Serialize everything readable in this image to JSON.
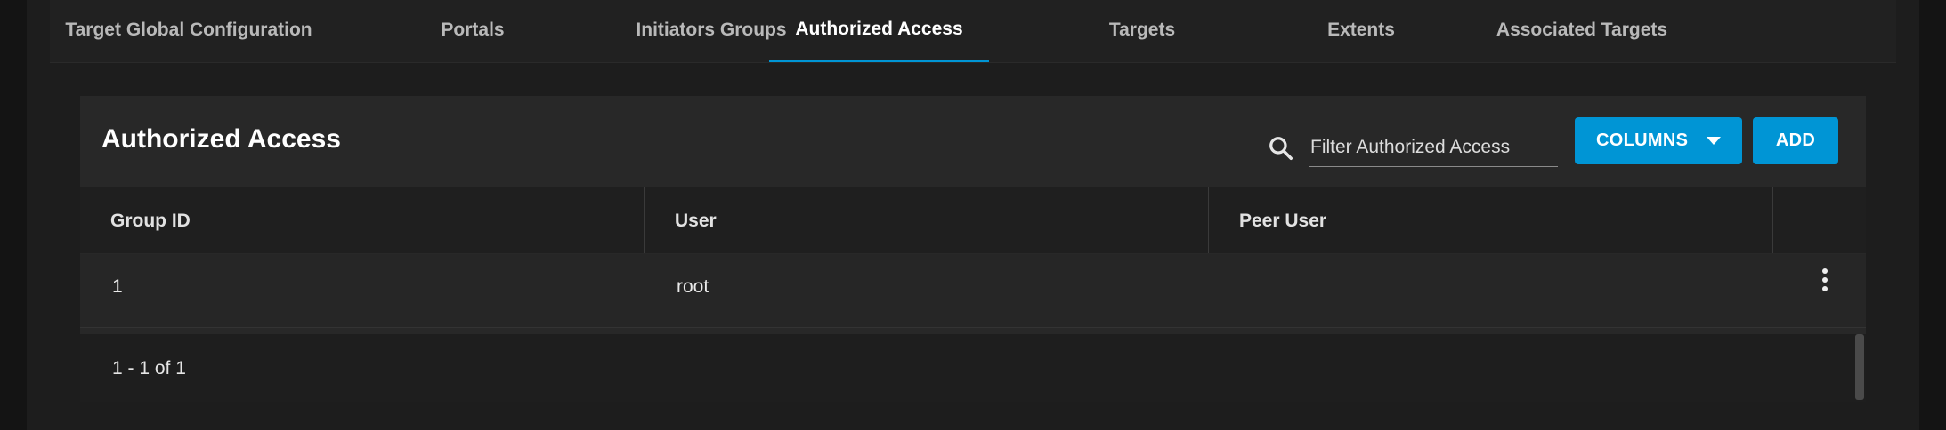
{
  "tabs": [
    {
      "label": "Target Global Configuration",
      "active": false
    },
    {
      "label": "Portals",
      "active": false
    },
    {
      "label": "Initiators Groups",
      "active": false
    },
    {
      "label": "Authorized Access",
      "active": true
    },
    {
      "label": "Targets",
      "active": false
    },
    {
      "label": "Extents",
      "active": false
    },
    {
      "label": "Associated Targets",
      "active": false
    }
  ],
  "card": {
    "title": "Authorized Access",
    "search": {
      "placeholder": "Filter Authorized Access",
      "value": "",
      "icon": "search-icon"
    },
    "columns_button": "COLUMNS",
    "add_button": "ADD"
  },
  "table": {
    "headers": [
      "Group ID",
      "User",
      "Peer User",
      ""
    ],
    "rows": [
      {
        "group_id": "1",
        "user": "root",
        "peer_user": ""
      }
    ]
  },
  "pagination": {
    "summary": "1 - 1 of 1"
  },
  "colors": {
    "accent": "#0095d5",
    "background": "#1d1d1d",
    "card": "#282828"
  }
}
